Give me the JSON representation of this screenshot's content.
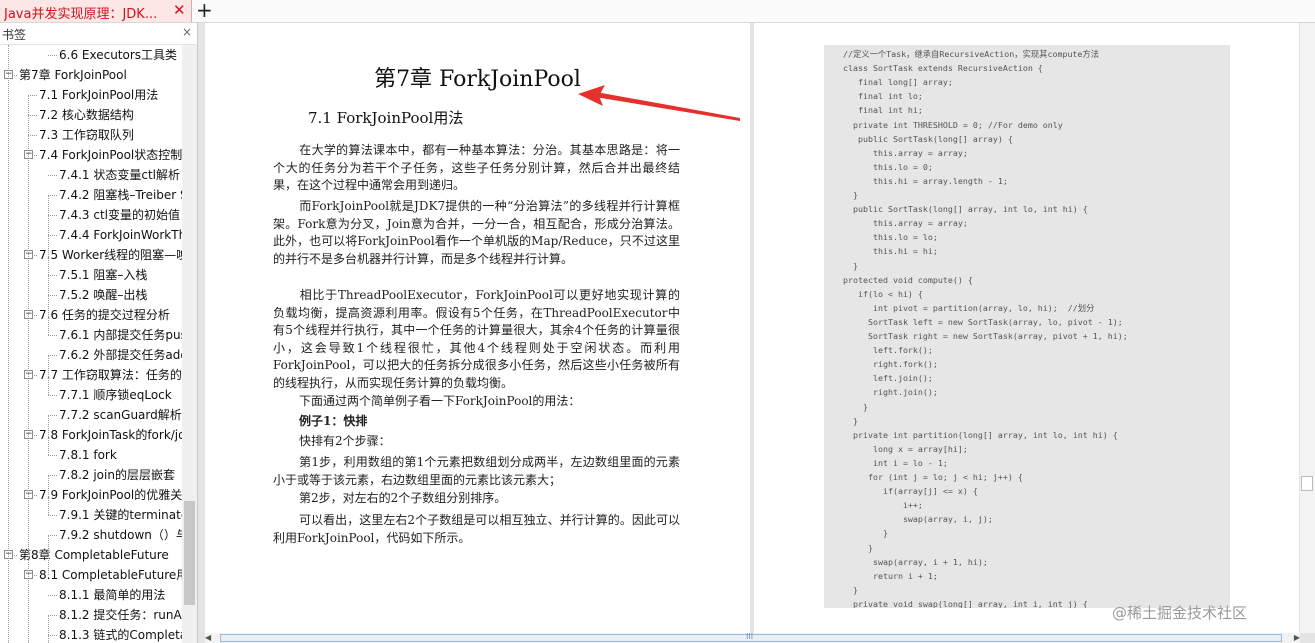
{
  "tab": {
    "title": "Java并发实现原理：JDK...",
    "close": "✕",
    "new_tab": "+"
  },
  "sidebar": {
    "title": "书签",
    "close": "×",
    "items": [
      {
        "label": "6.6 Executors工具类",
        "level": 2,
        "toggle": ""
      },
      {
        "label": "第7章 ForkJoinPool",
        "level": 0,
        "toggle": "−"
      },
      {
        "label": "7.1 ForkJoinPool用法",
        "level": 1,
        "toggle": ""
      },
      {
        "label": "7.2 核心数据结构",
        "level": 1,
        "toggle": ""
      },
      {
        "label": "7.3 工作窃取队列",
        "level": 1,
        "toggle": ""
      },
      {
        "label": "7.4 ForkJoinPool状态控制",
        "level": 1,
        "toggle": "−"
      },
      {
        "label": "7.4.1 状态变量ctl解析",
        "level": 2,
        "toggle": ""
      },
      {
        "label": "7.4.2 阻塞栈–Treiber Stack",
        "level": 2,
        "toggle": ""
      },
      {
        "label": "7.4.3 ctl变量的初始值",
        "level": 2,
        "toggle": ""
      },
      {
        "label": "7.4.4 ForkJoinWorkThread",
        "level": 2,
        "toggle": ""
      },
      {
        "label": "7.5 Worker线程的阻塞—唤醒",
        "level": 1,
        "toggle": "−"
      },
      {
        "label": "7.5.1 阻塞–入栈",
        "level": 2,
        "toggle": ""
      },
      {
        "label": "7.5.2 唤醒–出栈",
        "level": 2,
        "toggle": ""
      },
      {
        "label": "7.6 任务的提交过程分析",
        "level": 1,
        "toggle": "−"
      },
      {
        "label": "7.6.1 内部提交任务push",
        "level": 2,
        "toggle": ""
      },
      {
        "label": "7.6.2 外部提交任务addSubmission",
        "level": 2,
        "toggle": ""
      },
      {
        "label": "7.7 工作窃取算法：任务的执行",
        "level": 1,
        "toggle": "−"
      },
      {
        "label": "7.7.1 顺序锁eqLock",
        "level": 2,
        "toggle": ""
      },
      {
        "label": "7.7.2 scanGuard解析",
        "level": 2,
        "toggle": ""
      },
      {
        "label": "7.8 ForkJoinTask的fork/join",
        "level": 1,
        "toggle": "−"
      },
      {
        "label": "7.8.1 fork",
        "level": 2,
        "toggle": ""
      },
      {
        "label": "7.8.2 join的层层嵌套",
        "level": 2,
        "toggle": ""
      },
      {
        "label": "7.9 ForkJoinPool的优雅关闭",
        "level": 1,
        "toggle": "−"
      },
      {
        "label": "7.9.1 关键的terminate",
        "level": 2,
        "toggle": ""
      },
      {
        "label": "7.9.2 shutdown（）与shutdownNow",
        "level": 2,
        "toggle": ""
      },
      {
        "label": "第8章 CompletableFuture",
        "level": 0,
        "toggle": "−"
      },
      {
        "label": "8.1 CompletableFuture用法",
        "level": 1,
        "toggle": "−"
      },
      {
        "label": "8.1.1 最简单的用法",
        "level": 2,
        "toggle": ""
      },
      {
        "label": "8.1.2 提交任务：runAsync",
        "level": 2,
        "toggle": ""
      },
      {
        "label": "8.1.3 链式的CompletableFuture",
        "level": 2,
        "toggle": ""
      }
    ]
  },
  "left_page": {
    "chapter_title": "第7章  ForkJoinPool",
    "section_title": "7.1  ForkJoinPool用法",
    "paragraphs": [
      {
        "text": "在大学的算法课本中，都有一种基本算法：分治。其基本思路是：将一个大的任务分为若干个子任务，这些子任务分别计算，然后合并出最终结果，在这个过程中通常会用到递归。",
        "indent": true,
        "bold": false
      },
      {
        "text": "而ForkJoinPool就是JDK7提供的一种“分治算法”的多线程并行计算框架。Fork意为分叉，Join意为合并，一分一合，相互配合，形成分治算法。此外，也可以将ForkJoinPool看作一个单机版的Map/Reduce，只不过这里的并行不是多台机器并行计算，而是多个线程并行计算。",
        "indent": true,
        "bold": false
      },
      {
        "text": "相比于ThreadPoolExecutor，ForkJoinPool可以更好地实现计算的负载均衡，提高资源利用率。假设有5个任务，在ThreadPoolExecutor中有5个线程并行执行，其中一个任务的计算量很大，其余4个任务的计算量很小，这会导致1个线程很忙，其他4个线程则处于空闲状态。而利用ForkJoinPool，可以把大的任务拆分成很多小任务，然后这些小任务被所有的线程执行，从而实现任务计算的负载均衡。",
        "indent": true,
        "bold": false
      },
      {
        "text": "下面通过两个简单例子看一下ForkJoinPool的用法：",
        "indent": true,
        "bold": false
      },
      {
        "text": "例子1：快排",
        "indent": true,
        "bold": true
      },
      {
        "text": "快排有2个步骤：",
        "indent": true,
        "bold": false
      },
      {
        "text": "第1步，利用数组的第1个元素把数组划分成两半，左边数组里面的元素小于或等于该元素，右边数组里面的元素比该元素大；",
        "indent": true,
        "bold": false
      },
      {
        "text": "第2步，对左右的2个子数组分别排序。",
        "indent": true,
        "bold": false
      },
      {
        "text": "可以看出，这里左右2个子数组是可以相互独立、并行计算的。因此可以利用ForkJoinPool，代码如下所示。",
        "indent": true,
        "bold": false
      }
    ]
  },
  "code": {
    "lines": [
      "//定义一个Task，继承自RecursiveAction，实现其compute方法",
      "class SortTask extends RecursiveAction {",
      "   final long[] array;",
      "   final int lo;",
      "   final int hi;",
      "  private int THRESHOLD = 0; //For demo only",
      "   public SortTask(long[] array) {",
      "      this.array = array;",
      "      this.lo = 0;",
      "      this.hi = array.length - 1;",
      "  }",
      "  public SortTask(long[] array, int lo, int hi) {",
      "      this.array = array;",
      "      this.lo = lo;",
      "      this.hi = hi;",
      "  }",
      "protected void compute() {",
      "   if(lo < hi) {",
      "      int pivot = partition(array, lo, hi);  //划分",
      "     SortTask left = new SortTask(array, lo, pivot - 1);",
      "     SortTask right = new SortTask(array, pivot + 1, hi);",
      "      left.fork();",
      "      right.fork();",
      "      left.join();",
      "      right.join();",
      "    }",
      "  }",
      "  private int partition(long[] array, int lo, int hi) {",
      "      long x = array[hi];",
      "      int i = lo - 1;",
      "     for (int j = lo; j < hi; j++) {",
      "        if(array[j] <= x) {",
      "            i++;",
      "            swap(array, i, j);",
      "        }",
      "     }",
      "      swap(array, i + 1, hi);",
      "      return i + 1;",
      "  }",
      "  private void swap(long[] array, int i, int j) {"
    ]
  },
  "watermark": "@稀土掘金技术社区",
  "scrollbar": {
    "h_left": "◀",
    "h_right": "▶",
    "h_grip": "III"
  }
}
